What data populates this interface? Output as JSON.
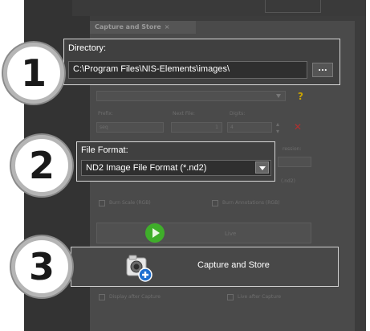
{
  "panel": {
    "tab_title": "Capture and Store",
    "tab_close": "×"
  },
  "directory": {
    "label": "Directory:",
    "path": "C:\\Program Files\\NIS-Elements\\images\\",
    "browse_label": "..."
  },
  "background": {
    "prefix_label": "Prefix:",
    "prefix_value": "seq",
    "next_file_label": "Next File:",
    "next_file_value": "1",
    "digits_label": "Digits:",
    "digits_value": "4",
    "compression_label": "ression:",
    "format_hint": "(.nd2)",
    "burn_scale_label": "Burn Scale (RGB)",
    "burn_annotations_label": "Burn Annotations (RGB)",
    "live_label": "Live",
    "display_after_capture_label": "Display after Capture",
    "live_after_capture_label": "Live after Capture"
  },
  "file_format": {
    "label": "File Format:",
    "selected": "ND2 Image File Format (*.nd2)"
  },
  "capture": {
    "button_label": "Capture and Store"
  },
  "callouts": [
    "1",
    "2",
    "3"
  ],
  "colors": {
    "app_background": "#3c3c3c",
    "panel_background": "#4a4a4a",
    "callout_border": "#d8d8d8",
    "live_green": "#3fae2a",
    "capture_icon_blue": "#1e6fd0"
  }
}
